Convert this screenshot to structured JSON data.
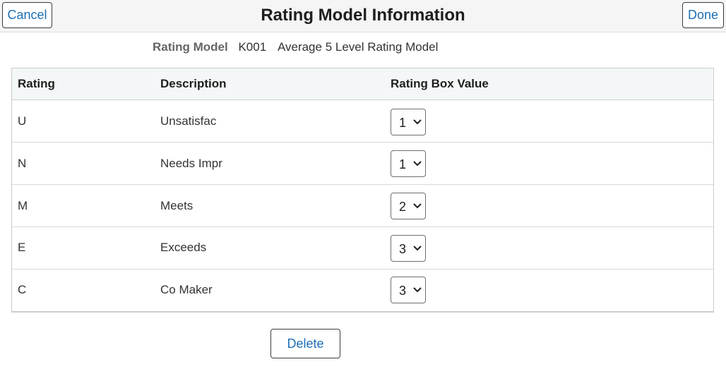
{
  "header": {
    "title": "Rating Model Information",
    "cancel_label": "Cancel",
    "done_label": "Done"
  },
  "rating_model": {
    "label": "Rating Model",
    "code": "K001",
    "description": "Average 5 Level Rating Model"
  },
  "grid": {
    "columns": [
      "Rating",
      "Description",
      "Rating Box Value"
    ],
    "rows": [
      {
        "rating": "U",
        "description": "Unsatisfac",
        "box_value": "1"
      },
      {
        "rating": "N",
        "description": "Needs Impr",
        "box_value": "1"
      },
      {
        "rating": "M",
        "description": "Meets",
        "box_value": "2"
      },
      {
        "rating": "E",
        "description": "Exceeds",
        "box_value": "3"
      },
      {
        "rating": "C",
        "description": "Co Maker",
        "box_value": "3"
      }
    ]
  },
  "actions": {
    "delete_label": "Delete"
  },
  "colors": {
    "link_blue": "#1c6fb5",
    "header_bg": "#f5f5f5",
    "grid_header_bg": "#f4f7f8"
  }
}
